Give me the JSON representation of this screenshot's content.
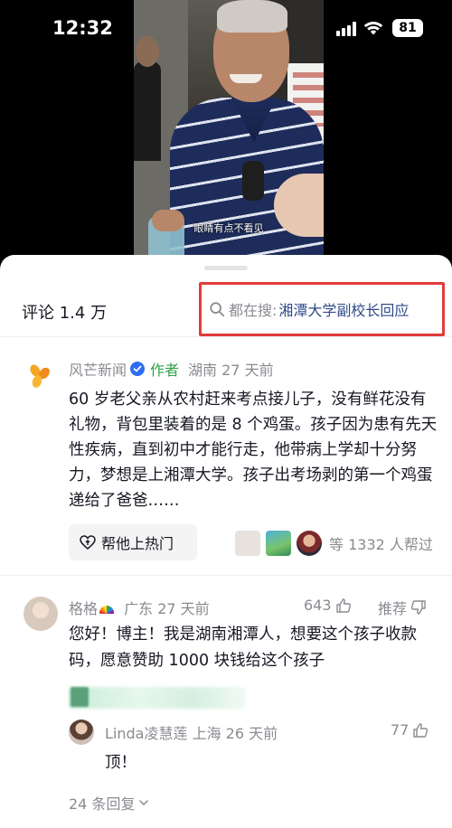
{
  "status_bar": {
    "time": "12:32",
    "battery": "81"
  },
  "video": {
    "subtitle": "眼睛有点不看见"
  },
  "sheet": {
    "comment_count": "评论 1.4 万",
    "search": {
      "prefix": "都在搜:",
      "term": "湘潭大学副校长回应"
    }
  },
  "post": {
    "author": "风芒新闻",
    "author_tag": "作者",
    "location_time": "湖南 27 天前",
    "text": "60 岁老父亲从农村赶来考点接儿子，没有鲜花没有礼物，背包里装着的是 8 个鸡蛋。孩子因为患有先天性疾病，直到初中才能行走，他带病上学却十分努力，梦想是上湘潭大学。孩子出考场剥的第一个鸡蛋递给了爸爸……",
    "hot_button": "帮他上热门",
    "helpers_text": "等 1332 人帮过"
  },
  "comment": {
    "user": "格格",
    "location_time": "广东  27 天前",
    "likes": "643",
    "recommend": "推荐",
    "text": "您好！博主！我是湖南湘潭人，想要这个孩子收款码，愿意赞助 1000 块钱给这个孩子"
  },
  "reply": {
    "user": "Linda凌慧莲",
    "location_time": "上海  26 天前",
    "likes": "77",
    "text": "顶！"
  },
  "more_replies": "24 条回复",
  "colors": {
    "highlight_border": "#e23b3b",
    "search_term": "#2f4a8a",
    "author_tag": "#2fa24a",
    "verified": "#2f6cf5"
  }
}
